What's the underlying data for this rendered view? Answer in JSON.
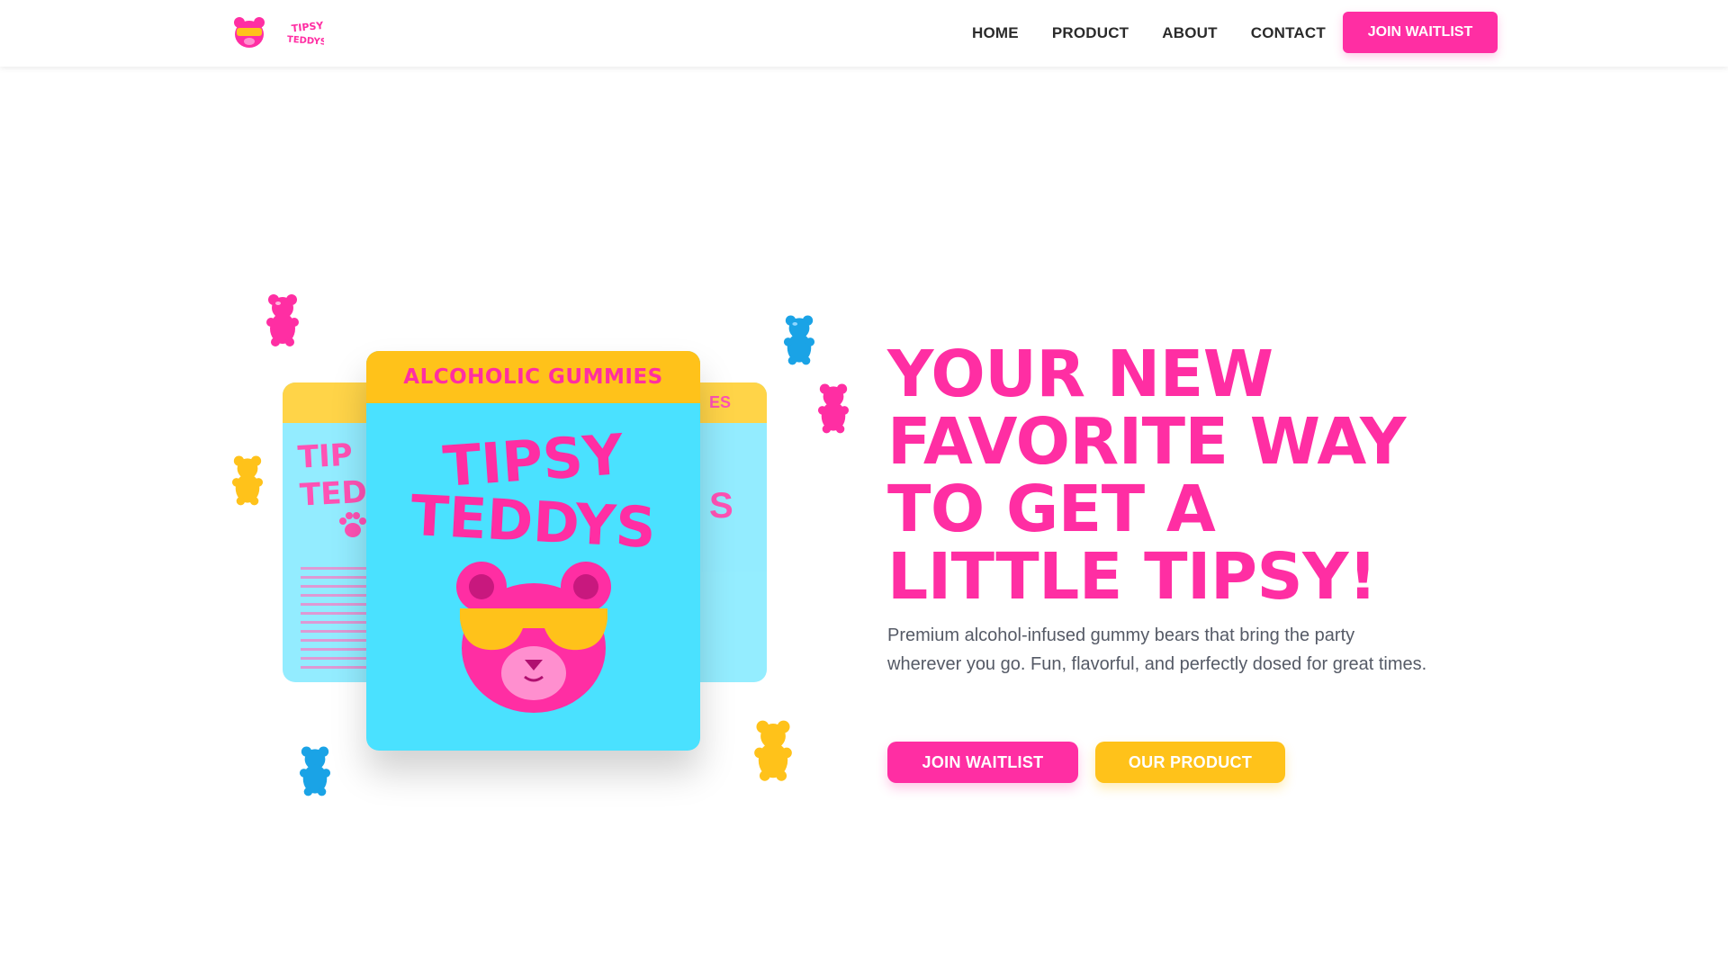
{
  "brand": {
    "name_line1": "TIPSY",
    "name_line2": "TEDDYS",
    "logo_icon": "bear-sunglasses-icon"
  },
  "nav": {
    "items": [
      {
        "label": "HOME"
      },
      {
        "label": "PRODUCT"
      },
      {
        "label": "ABOUT"
      },
      {
        "label": "CONTACT"
      }
    ],
    "cta_label": "JOIN WAITLIST"
  },
  "product_pack": {
    "label": "ALCOHOLIC GUMMIES",
    "title_line1": "TIPSY",
    "title_line2": "TEDDYS",
    "back_left_title_line1": "TIP",
    "back_left_title_line2": "TEDD",
    "back_right_label": "ES",
    "back_right_letter": "S"
  },
  "hero": {
    "title": "YOUR NEW FAVORITE WAY TO GET A LITTLE TIPSY!",
    "subtitle": "Premium alcohol-infused gummy bears that bring the party wherever you go. Fun, flavorful, and perfectly dosed for great times.",
    "primary_button": "JOIN WAITLIST",
    "secondary_button": "OUR PRODUCT"
  },
  "colors": {
    "pink": "#ff2ea3",
    "yellow": "#ffc21a",
    "cyan": "#4ae1ff",
    "blue": "#1aa3e6"
  }
}
